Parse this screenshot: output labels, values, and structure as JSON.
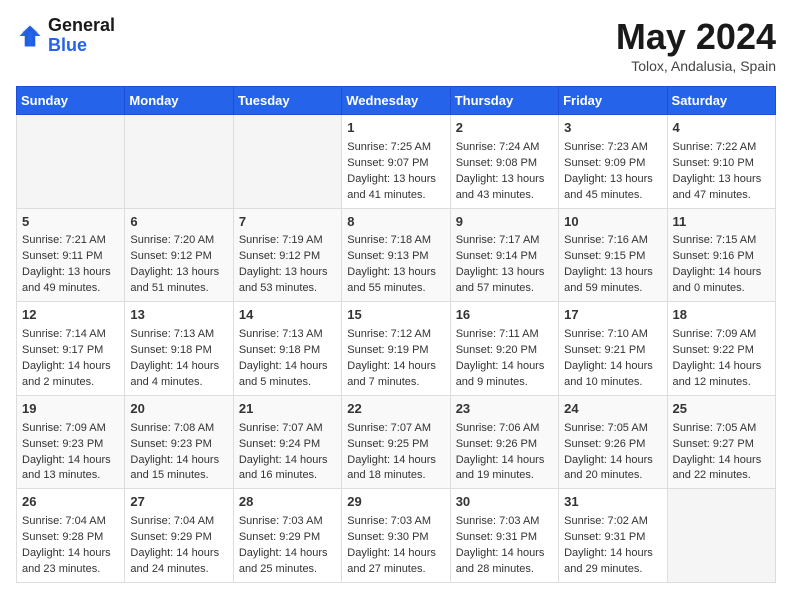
{
  "header": {
    "logo_general": "General",
    "logo_blue": "Blue",
    "month_title": "May 2024",
    "location": "Tolox, Andalusia, Spain"
  },
  "weekdays": [
    "Sunday",
    "Monday",
    "Tuesday",
    "Wednesday",
    "Thursday",
    "Friday",
    "Saturday"
  ],
  "weeks": [
    [
      {
        "day": "",
        "sunrise": "",
        "sunset": "",
        "daylight": ""
      },
      {
        "day": "",
        "sunrise": "",
        "sunset": "",
        "daylight": ""
      },
      {
        "day": "",
        "sunrise": "",
        "sunset": "",
        "daylight": ""
      },
      {
        "day": "1",
        "sunrise": "Sunrise: 7:25 AM",
        "sunset": "Sunset: 9:07 PM",
        "daylight": "Daylight: 13 hours and 41 minutes."
      },
      {
        "day": "2",
        "sunrise": "Sunrise: 7:24 AM",
        "sunset": "Sunset: 9:08 PM",
        "daylight": "Daylight: 13 hours and 43 minutes."
      },
      {
        "day": "3",
        "sunrise": "Sunrise: 7:23 AM",
        "sunset": "Sunset: 9:09 PM",
        "daylight": "Daylight: 13 hours and 45 minutes."
      },
      {
        "day": "4",
        "sunrise": "Sunrise: 7:22 AM",
        "sunset": "Sunset: 9:10 PM",
        "daylight": "Daylight: 13 hours and 47 minutes."
      }
    ],
    [
      {
        "day": "5",
        "sunrise": "Sunrise: 7:21 AM",
        "sunset": "Sunset: 9:11 PM",
        "daylight": "Daylight: 13 hours and 49 minutes."
      },
      {
        "day": "6",
        "sunrise": "Sunrise: 7:20 AM",
        "sunset": "Sunset: 9:12 PM",
        "daylight": "Daylight: 13 hours and 51 minutes."
      },
      {
        "day": "7",
        "sunrise": "Sunrise: 7:19 AM",
        "sunset": "Sunset: 9:12 PM",
        "daylight": "Daylight: 13 hours and 53 minutes."
      },
      {
        "day": "8",
        "sunrise": "Sunrise: 7:18 AM",
        "sunset": "Sunset: 9:13 PM",
        "daylight": "Daylight: 13 hours and 55 minutes."
      },
      {
        "day": "9",
        "sunrise": "Sunrise: 7:17 AM",
        "sunset": "Sunset: 9:14 PM",
        "daylight": "Daylight: 13 hours and 57 minutes."
      },
      {
        "day": "10",
        "sunrise": "Sunrise: 7:16 AM",
        "sunset": "Sunset: 9:15 PM",
        "daylight": "Daylight: 13 hours and 59 minutes."
      },
      {
        "day": "11",
        "sunrise": "Sunrise: 7:15 AM",
        "sunset": "Sunset: 9:16 PM",
        "daylight": "Daylight: 14 hours and 0 minutes."
      }
    ],
    [
      {
        "day": "12",
        "sunrise": "Sunrise: 7:14 AM",
        "sunset": "Sunset: 9:17 PM",
        "daylight": "Daylight: 14 hours and 2 minutes."
      },
      {
        "day": "13",
        "sunrise": "Sunrise: 7:13 AM",
        "sunset": "Sunset: 9:18 PM",
        "daylight": "Daylight: 14 hours and 4 minutes."
      },
      {
        "day": "14",
        "sunrise": "Sunrise: 7:13 AM",
        "sunset": "Sunset: 9:18 PM",
        "daylight": "Daylight: 14 hours and 5 minutes."
      },
      {
        "day": "15",
        "sunrise": "Sunrise: 7:12 AM",
        "sunset": "Sunset: 9:19 PM",
        "daylight": "Daylight: 14 hours and 7 minutes."
      },
      {
        "day": "16",
        "sunrise": "Sunrise: 7:11 AM",
        "sunset": "Sunset: 9:20 PM",
        "daylight": "Daylight: 14 hours and 9 minutes."
      },
      {
        "day": "17",
        "sunrise": "Sunrise: 7:10 AM",
        "sunset": "Sunset: 9:21 PM",
        "daylight": "Daylight: 14 hours and 10 minutes."
      },
      {
        "day": "18",
        "sunrise": "Sunrise: 7:09 AM",
        "sunset": "Sunset: 9:22 PM",
        "daylight": "Daylight: 14 hours and 12 minutes."
      }
    ],
    [
      {
        "day": "19",
        "sunrise": "Sunrise: 7:09 AM",
        "sunset": "Sunset: 9:23 PM",
        "daylight": "Daylight: 14 hours and 13 minutes."
      },
      {
        "day": "20",
        "sunrise": "Sunrise: 7:08 AM",
        "sunset": "Sunset: 9:23 PM",
        "daylight": "Daylight: 14 hours and 15 minutes."
      },
      {
        "day": "21",
        "sunrise": "Sunrise: 7:07 AM",
        "sunset": "Sunset: 9:24 PM",
        "daylight": "Daylight: 14 hours and 16 minutes."
      },
      {
        "day": "22",
        "sunrise": "Sunrise: 7:07 AM",
        "sunset": "Sunset: 9:25 PM",
        "daylight": "Daylight: 14 hours and 18 minutes."
      },
      {
        "day": "23",
        "sunrise": "Sunrise: 7:06 AM",
        "sunset": "Sunset: 9:26 PM",
        "daylight": "Daylight: 14 hours and 19 minutes."
      },
      {
        "day": "24",
        "sunrise": "Sunrise: 7:05 AM",
        "sunset": "Sunset: 9:26 PM",
        "daylight": "Daylight: 14 hours and 20 minutes."
      },
      {
        "day": "25",
        "sunrise": "Sunrise: 7:05 AM",
        "sunset": "Sunset: 9:27 PM",
        "daylight": "Daylight: 14 hours and 22 minutes."
      }
    ],
    [
      {
        "day": "26",
        "sunrise": "Sunrise: 7:04 AM",
        "sunset": "Sunset: 9:28 PM",
        "daylight": "Daylight: 14 hours and 23 minutes."
      },
      {
        "day": "27",
        "sunrise": "Sunrise: 7:04 AM",
        "sunset": "Sunset: 9:29 PM",
        "daylight": "Daylight: 14 hours and 24 minutes."
      },
      {
        "day": "28",
        "sunrise": "Sunrise: 7:03 AM",
        "sunset": "Sunset: 9:29 PM",
        "daylight": "Daylight: 14 hours and 25 minutes."
      },
      {
        "day": "29",
        "sunrise": "Sunrise: 7:03 AM",
        "sunset": "Sunset: 9:30 PM",
        "daylight": "Daylight: 14 hours and 27 minutes."
      },
      {
        "day": "30",
        "sunrise": "Sunrise: 7:03 AM",
        "sunset": "Sunset: 9:31 PM",
        "daylight": "Daylight: 14 hours and 28 minutes."
      },
      {
        "day": "31",
        "sunrise": "Sunrise: 7:02 AM",
        "sunset": "Sunset: 9:31 PM",
        "daylight": "Daylight: 14 hours and 29 minutes."
      },
      {
        "day": "",
        "sunrise": "",
        "sunset": "",
        "daylight": ""
      }
    ]
  ]
}
